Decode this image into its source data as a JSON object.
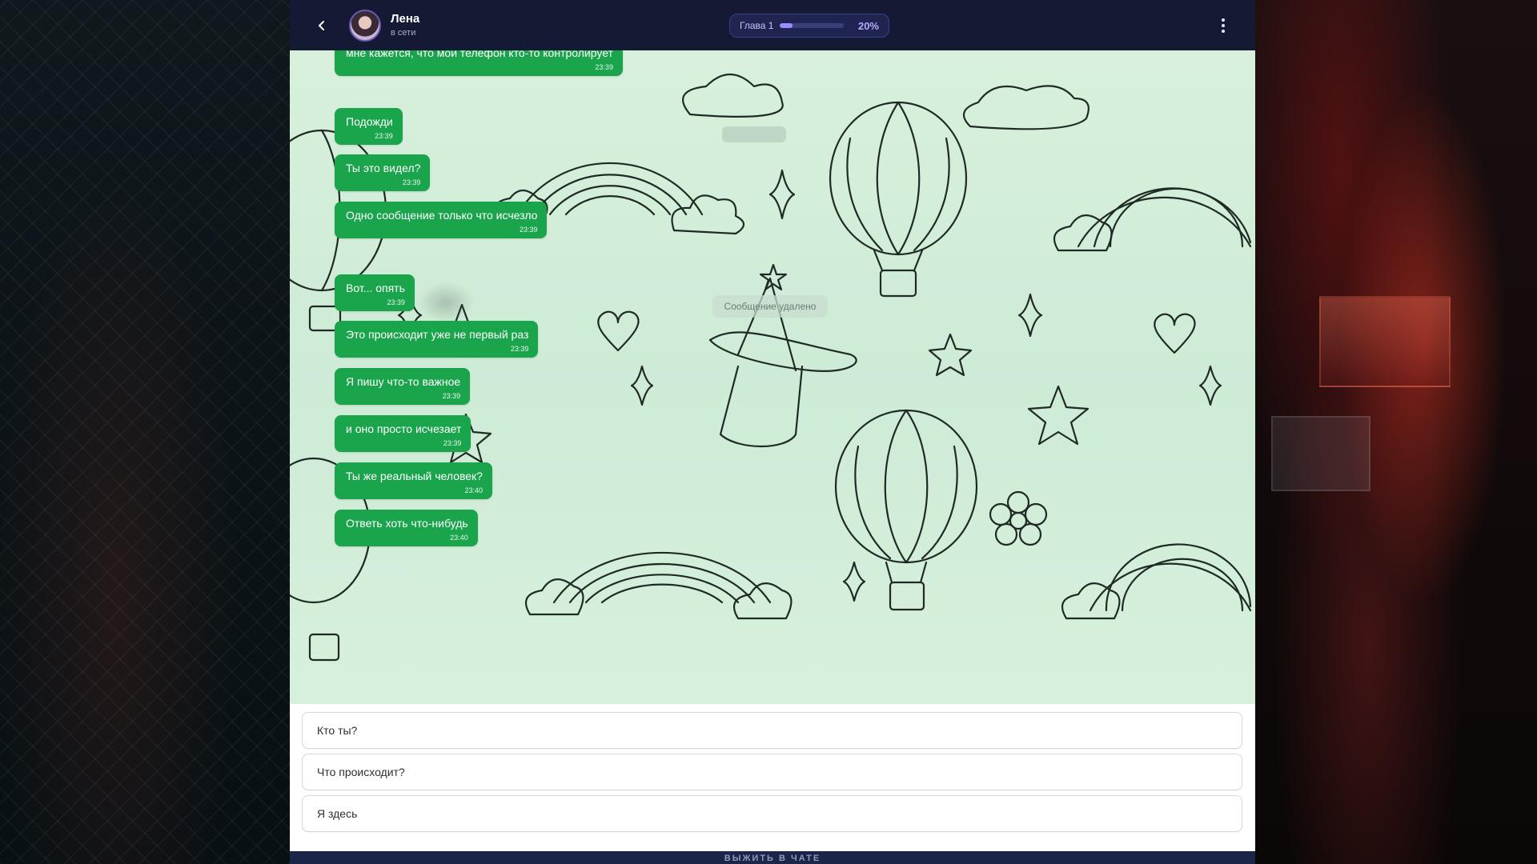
{
  "header": {
    "contact_name": "Лена",
    "contact_status": "в сети",
    "chapter_label": "Глава 1",
    "progress_percent": 20,
    "progress_label": "20%"
  },
  "chat": {
    "messages": [
      {
        "text": "мне кажется, что мой телефон кто-то контролирует",
        "time": "23:39"
      },
      {
        "text": "Подожди",
        "time": "23:39"
      },
      {
        "text": "Ты это видел?",
        "time": "23:39"
      },
      {
        "text": "Одно сообщение только что исчезло",
        "time": "23:39"
      },
      {
        "text": "Вот... опять",
        "time": "23:39"
      },
      {
        "text": "Это происходит уже не первый раз",
        "time": "23:39"
      },
      {
        "text": "Я пишу что-то важное",
        "time": "23:39"
      },
      {
        "text": "и оно просто исчезает",
        "time": "23:39"
      },
      {
        "text": "Ты же реальный человек?",
        "time": "23:40"
      },
      {
        "text": "Ответь хоть что-нибудь",
        "time": "23:40"
      }
    ],
    "deleted_note": "Сообщение удалено"
  },
  "replies": [
    {
      "label": "Кто ты?"
    },
    {
      "label": "Что происходит?"
    },
    {
      "label": "Я здесь"
    }
  ],
  "footer": {
    "label": "ВЫЖИТЬ В ЧАТЕ"
  },
  "icons": {
    "back": "chevron-left-icon",
    "menu": "more-vertical-icon"
  },
  "colors": {
    "header_bg": "#141a33",
    "bubble": "#1aa54c",
    "chat_bg": "#d4eed9",
    "progress": "#9c8cff",
    "footer_bg": "#1a2547"
  }
}
